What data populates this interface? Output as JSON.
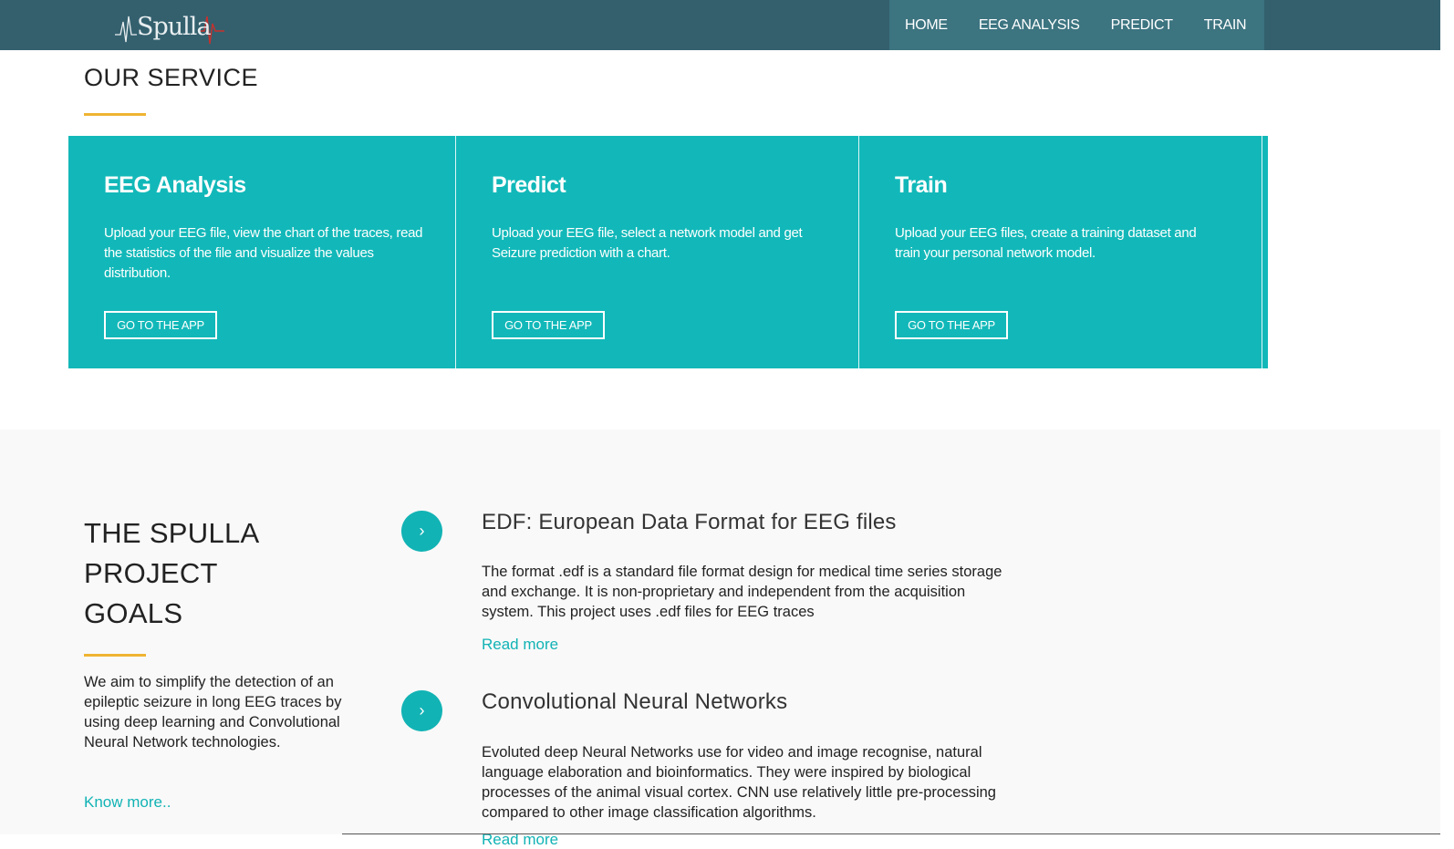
{
  "brand": {
    "logo_text": "Spulla"
  },
  "nav": {
    "items": [
      "HOME",
      "EEG ANALYSIS",
      "PREDICT",
      "TRAIN"
    ]
  },
  "service": {
    "title": "OUR SERVICE",
    "cards": [
      {
        "title": "EEG Analysis",
        "text": "Upload your EEG file, view the chart of the traces, read the statistics of the file and visualize the values distribution.",
        "button": "GO TO THE APP"
      },
      {
        "title": "Predict",
        "text": "Upload your EEG file, select a network model and get Seizure prediction with a chart.",
        "button": "GO TO THE APP"
      },
      {
        "title": "Train",
        "text": "Upload your EEG files, create a training dataset and train your personal network model.",
        "button": "GO TO THE APP"
      }
    ]
  },
  "goals": {
    "title_lines": [
      "THE SPULLA",
      "PROJECT",
      "GOALS"
    ],
    "description": "We aim to simplify the detection of an epileptic seizure in long EEG traces by using deep learning and Convolutional Neural Network technologies.",
    "know_more": "Know more..",
    "items": [
      {
        "title": "EDF: European Data Format for EEG files",
        "text": "The format .edf is a standard file format design for medical time series storage and exchange. It is non-proprietary and independent from the acquisition system. This project uses .edf files for EEG traces",
        "link": "Read more"
      },
      {
        "title": "Convolutional Neural Networks",
        "text": "Evoluted deep Neural Networks use for video and image recognise, natural language elaboration and bioinformatics. They were inspired by biological processes of the animal visual cortex. CNN use relatively little pre-processing compared to other image classification algorithms.",
        "link": "Read more"
      }
    ]
  },
  "colors": {
    "header": "#34606e",
    "accent": "#12b8b9",
    "underline": "#efb432"
  },
  "icons": {
    "goal_item": "chevron-right-icon"
  }
}
